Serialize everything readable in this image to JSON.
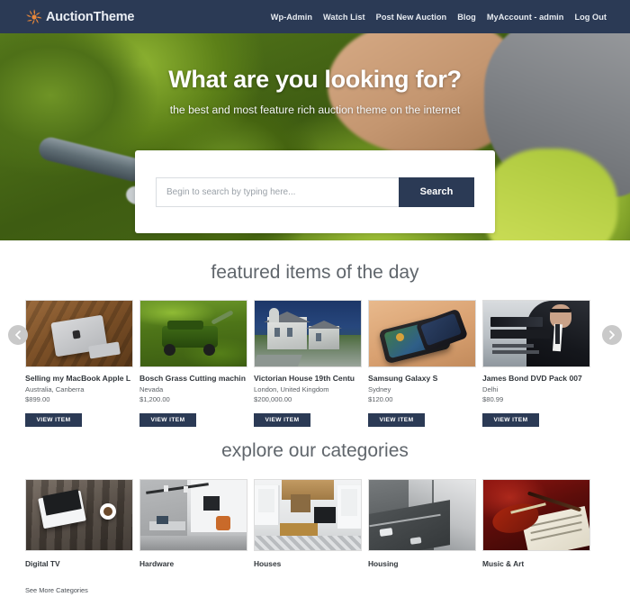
{
  "header": {
    "brand": "AuctionTheme",
    "brand_icon": "sunburst-icon",
    "nav": [
      {
        "label": "Wp-Admin"
      },
      {
        "label": "Watch List"
      },
      {
        "label": "Post New Auction"
      },
      {
        "label": "Blog"
      },
      {
        "label": "MyAccount - admin"
      },
      {
        "label": "Log Out"
      }
    ]
  },
  "hero": {
    "title": "What are you looking for?",
    "subtitle": "the best and most feature rich auction theme on the internet"
  },
  "search": {
    "placeholder": "Begin to search by typing here...",
    "value": "",
    "button_label": "Search"
  },
  "featured": {
    "heading": "featured items of the day",
    "prev_icon": "chevron-left-icon",
    "next_icon": "chevron-right-icon",
    "view_label": "VIEW ITEM",
    "items": [
      {
        "title": "Selling my MacBook Apple L",
        "location": "Australia, Canberra",
        "price": "$899.00",
        "image": "macbook-on-wooden-table"
      },
      {
        "title": "Bosch Grass Cutting machin",
        "location": "Nevada",
        "price": "$1,200.00",
        "image": "green-lawn-mower"
      },
      {
        "title": "Victorian House 19th Centu",
        "location": "London, United Kingdom",
        "price": "$200,000.00",
        "image": "victorian-house"
      },
      {
        "title": "Samsung Galaxy S",
        "location": "Sydney",
        "price": "$120.00",
        "image": "smartphone-on-desk"
      },
      {
        "title": "James Bond DVD Pack 007",
        "location": "Delhi",
        "price": "$80.99",
        "image": "james-bond-dvd-cover"
      }
    ]
  },
  "categories": {
    "heading": "explore our categories",
    "more_label": "See More Categories",
    "items": [
      {
        "label": "Digital TV",
        "image": "laptop-and-coffee-on-wood"
      },
      {
        "label": "Hardware",
        "image": "modern-living-room"
      },
      {
        "label": "Houses",
        "image": "bright-kitchen-interior"
      },
      {
        "label": "Housing",
        "image": "city-street-aerial"
      },
      {
        "label": "Music & Art",
        "image": "violin-on-sheet-music"
      }
    ]
  },
  "colors": {
    "header_bg": "#2b3a55",
    "accent": "#2b3a55",
    "brand_icon": "#e8873a",
    "section_title": "#60666c"
  }
}
